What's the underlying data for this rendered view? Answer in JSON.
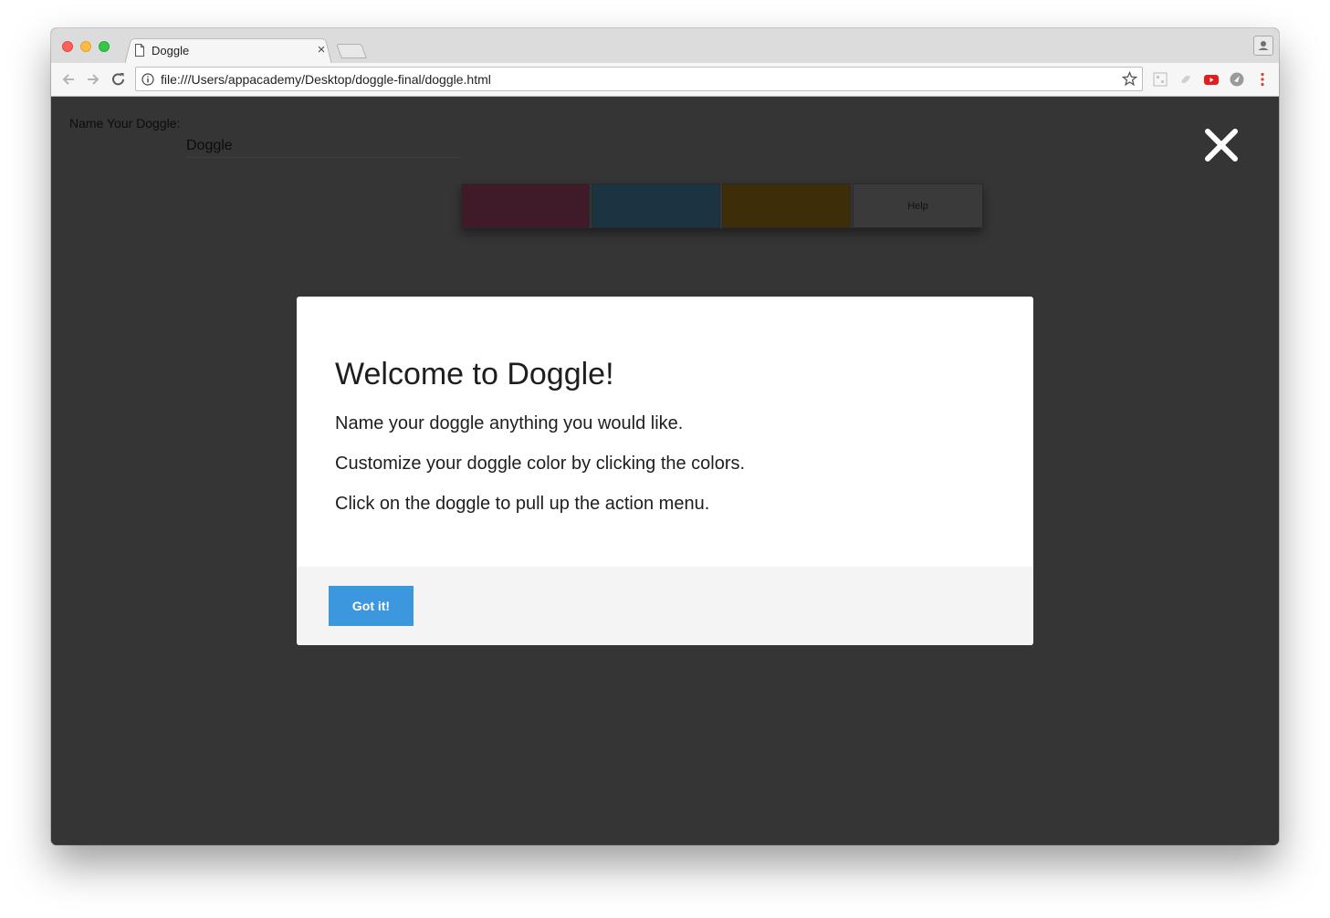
{
  "browser": {
    "tab_title": "Doggle",
    "tab_close_glyph": "×",
    "url": "file:///Users/appacademy/Desktop/doggle-final/doggle.html",
    "icons": [
      "back-arrow-icon",
      "forward-arrow-icon",
      "reload-icon",
      "info-icon",
      "star-icon",
      "profile-icon",
      "extension-icon",
      "youtube-icon",
      "menu-dots-icon"
    ]
  },
  "page": {
    "name_label": "Name Your Doggle:",
    "name_value": "Doggle",
    "swatches": [
      {
        "name": "magenta",
        "color": "#3f1a29"
      },
      {
        "name": "blue",
        "color": "#1b3442"
      },
      {
        "name": "amber",
        "color": "#3d2d08"
      }
    ],
    "help_label": "Help"
  },
  "modal": {
    "title": "Welcome to Doggle!",
    "lines": [
      "Name your doggle anything you would like.",
      "Customize your doggle color by clicking the colors.",
      "Click on the doggle to pull up the action menu."
    ],
    "button_label": "Got it!"
  },
  "colors": {
    "overlay_bg": "#353535",
    "button": "#3d97dd",
    "modal_footer": "#f4f4f4"
  }
}
